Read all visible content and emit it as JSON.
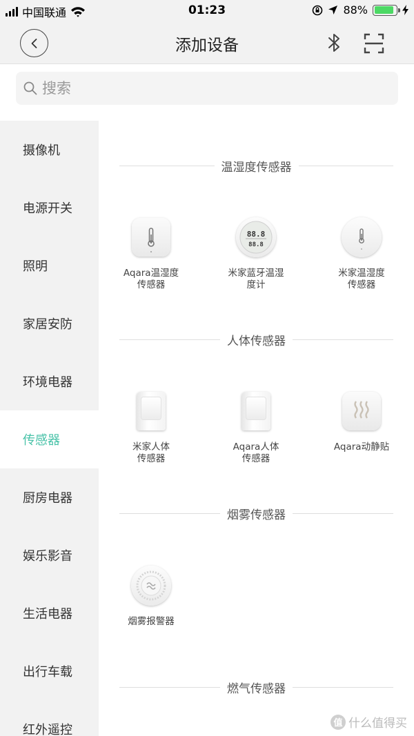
{
  "status_bar": {
    "carrier": "中国联通",
    "time": "01:23",
    "battery": "88%",
    "battery_level": 0.88
  },
  "header": {
    "title": "添加设备",
    "back_icon": "chevron-left-icon",
    "bluetooth_icon": "bluetooth-icon",
    "scan_icon": "scan-icon"
  },
  "search": {
    "placeholder": "搜索"
  },
  "sidebar": {
    "active_color": "#48c2a8",
    "items": [
      {
        "label": "摄像机"
      },
      {
        "label": "电源开关"
      },
      {
        "label": "照明"
      },
      {
        "label": "家居安防"
      },
      {
        "label": "环境电器"
      },
      {
        "label": "传感器"
      },
      {
        "label": "厨房电器"
      },
      {
        "label": "娱乐影音"
      },
      {
        "label": "生活电器"
      },
      {
        "label": "出行车载"
      },
      {
        "label": "红外遥控"
      }
    ]
  },
  "sections": [
    {
      "title": "温湿度传感器",
      "devices": [
        {
          "name": "Aqara温湿度\n传感器",
          "icon": "thermometer-square-icon"
        },
        {
          "name": "米家蓝牙温湿\n度计",
          "icon": "lcd-hygrometer-icon"
        },
        {
          "name": "米家温湿度\n传感器",
          "icon": "thermometer-round-icon"
        }
      ]
    },
    {
      "title": "人体传感器",
      "devices": [
        {
          "name": "米家人体\n传感器",
          "icon": "motion-sensor-icon"
        },
        {
          "name": "Aqara人体\n传感器",
          "icon": "motion-sensor-icon"
        },
        {
          "name": "Aqara动静贴",
          "icon": "vibration-sensor-icon"
        }
      ]
    },
    {
      "title": "烟雾传感器",
      "devices": [
        {
          "name": "烟雾报警器",
          "icon": "smoke-alarm-icon"
        }
      ]
    },
    {
      "title": "燃气传感器",
      "devices": []
    }
  ],
  "watermark": {
    "logo": "值",
    "text": "什么值得买"
  }
}
